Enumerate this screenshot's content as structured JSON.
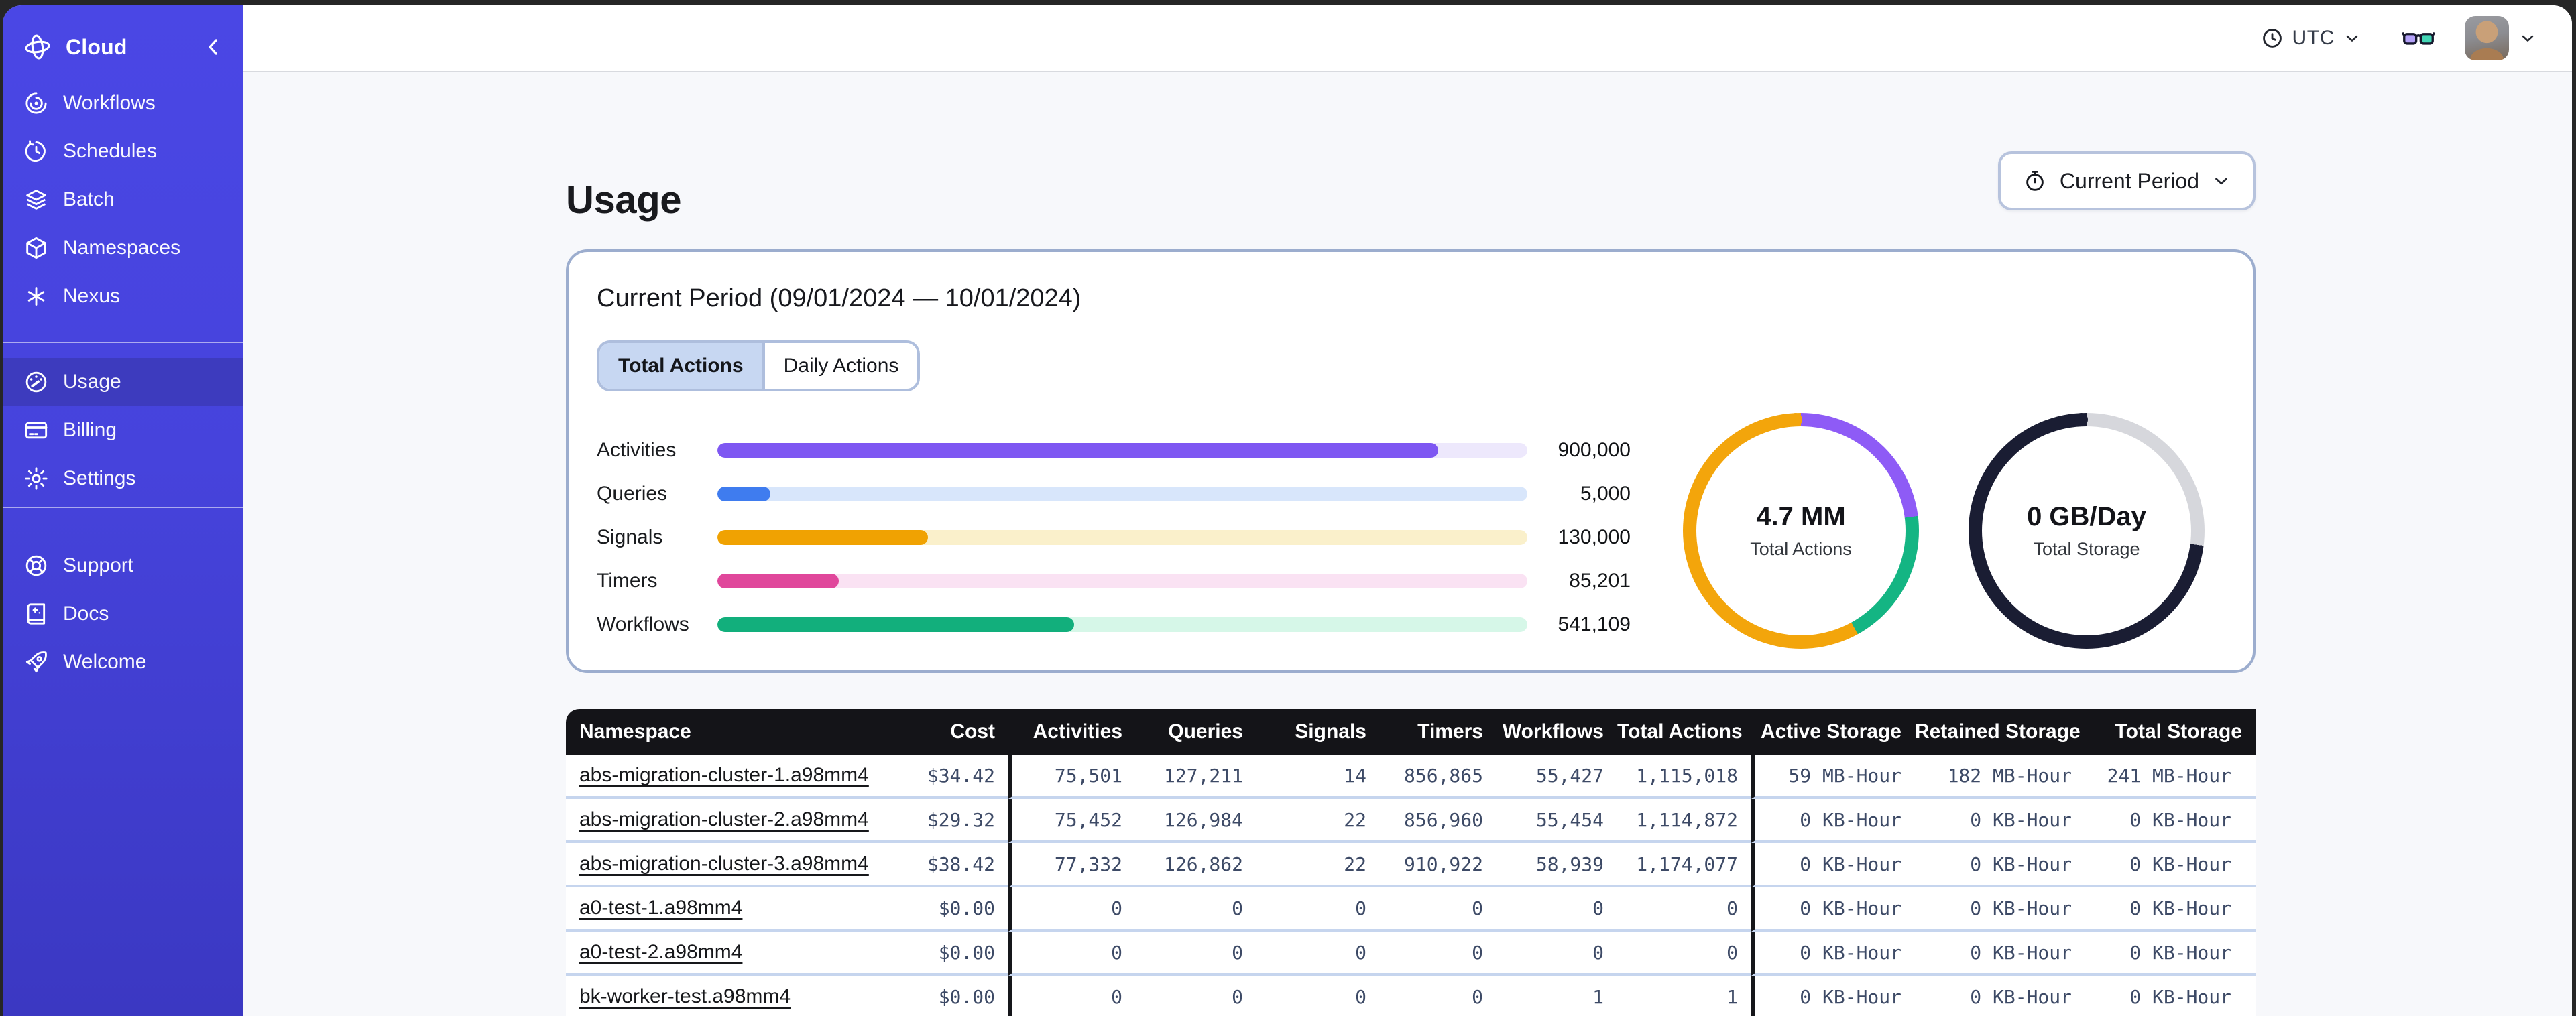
{
  "sidebar": {
    "brand_label": "Cloud",
    "primary": [
      {
        "label": "Workflows"
      },
      {
        "label": "Schedules"
      },
      {
        "label": "Batch"
      },
      {
        "label": "Namespaces"
      },
      {
        "label": "Nexus"
      }
    ],
    "account": [
      {
        "label": "Usage",
        "active": true
      },
      {
        "label": "Billing"
      },
      {
        "label": "Settings"
      }
    ],
    "footer": [
      {
        "label": "Support"
      },
      {
        "label": "Docs"
      },
      {
        "label": "Welcome"
      }
    ]
  },
  "topbar": {
    "timezone_label": "UTC"
  },
  "page": {
    "title": "Usage",
    "period_selector_label": "Current Period"
  },
  "usage_card": {
    "title": "Current Period (09/01/2024 — 10/01/2024)",
    "tabs": [
      {
        "label": "Total Actions",
        "active": true
      },
      {
        "label": "Daily Actions",
        "active": false
      }
    ]
  },
  "chart_data": [
    {
      "type": "bar",
      "title": "Current period usage by action type",
      "orientation": "horizontal",
      "categories": [
        "Activities",
        "Queries",
        "Signals",
        "Timers",
        "Workflows"
      ],
      "values": [
        900000,
        5000,
        130000,
        85201,
        541109
      ],
      "value_labels": [
        "900,000",
        "5,000",
        "130,000",
        "85,201",
        "541,109"
      ],
      "fill_pct": [
        89,
        6.5,
        26,
        15,
        44
      ],
      "bar_colors": [
        "#7E57F2",
        "#3F7CEF",
        "#F0A202",
        "#E0479B",
        "#12AF7C"
      ],
      "track_colors": [
        "#EDE8FC",
        "#D8E6FB",
        "#FAF0CB",
        "#FAE2F3",
        "#D6F7E8"
      ],
      "grid": false,
      "legend": false
    },
    {
      "type": "donut",
      "center_value": "4.7 MM",
      "center_label": "Total Actions",
      "cap_color": "#F3A50B",
      "segments": [
        {
          "color": "#8E5BF6",
          "pct": 23
        },
        {
          "color": "#14B583",
          "pct": 19
        },
        {
          "color": "#F3A50B",
          "pct": 58
        }
      ]
    },
    {
      "type": "donut",
      "center_value": "0 GB/Day",
      "center_label": "Total Storage",
      "cap_color": "#1A1D33",
      "segments": [
        {
          "color": "#D6D7DC",
          "pct": 27
        },
        {
          "color": "#1A1D33",
          "pct": 73
        }
      ]
    }
  ],
  "table": {
    "columns": [
      {
        "label": "Namespace"
      },
      {
        "label": "Cost"
      },
      {
        "label": "Activities"
      },
      {
        "label": "Queries"
      },
      {
        "label": "Signals"
      },
      {
        "label": "Timers"
      },
      {
        "label": "Workflows"
      },
      {
        "label": "Total Actions"
      },
      {
        "label": "Active Storage"
      },
      {
        "label": "Retained Storage"
      },
      {
        "label": "Total Storage"
      }
    ],
    "rows": [
      [
        "abs-migration-cluster-1.a98mm4",
        "$34.42",
        "75,501",
        "127,211",
        "14",
        "856,865",
        "55,427",
        "1,115,018",
        "59 MB-Hour",
        "182 MB-Hour",
        "241 MB-Hour"
      ],
      [
        "abs-migration-cluster-2.a98mm4",
        "$29.32",
        "75,452",
        "126,984",
        "22",
        "856,960",
        "55,454",
        "1,114,872",
        "0 KB-Hour",
        "0 KB-Hour",
        "0 KB-Hour"
      ],
      [
        "abs-migration-cluster-3.a98mm4",
        "$38.42",
        "77,332",
        "126,862",
        "22",
        "910,922",
        "58,939",
        "1,174,077",
        "0 KB-Hour",
        "0 KB-Hour",
        "0 KB-Hour"
      ],
      [
        "a0-test-1.a98mm4",
        "$0.00",
        "0",
        "0",
        "0",
        "0",
        "0",
        "0",
        "0 KB-Hour",
        "0 KB-Hour",
        "0 KB-Hour"
      ],
      [
        "a0-test-2.a98mm4",
        "$0.00",
        "0",
        "0",
        "0",
        "0",
        "0",
        "0",
        "0 KB-Hour",
        "0 KB-Hour",
        "0 KB-Hour"
      ],
      [
        "bk-worker-test.a98mm4",
        "$0.00",
        "0",
        "0",
        "0",
        "0",
        "1",
        "1",
        "0 KB-Hour",
        "0 KB-Hour",
        "0 KB-Hour"
      ]
    ]
  }
}
